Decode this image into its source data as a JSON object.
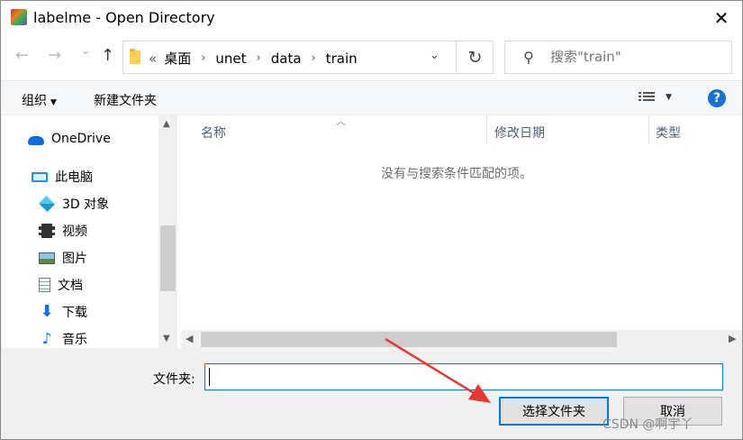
{
  "window": {
    "title": "labelme - Open Directory",
    "close_glyph": "✕"
  },
  "nav": {
    "back_glyph": "←",
    "forward_glyph": "→",
    "recent_glyph": "⌄",
    "up_glyph": "↑",
    "refresh_glyph": "↻",
    "dropdown_glyph": "⌄",
    "lead": "«",
    "breadcrumbs": [
      "桌面",
      "unet",
      "data",
      "train"
    ],
    "sep": "›"
  },
  "search": {
    "placeholder": "搜索\"train\""
  },
  "toolbar": {
    "organize": "组织",
    "new_folder": "新建文件夹",
    "help": "?"
  },
  "sidebar": {
    "items": [
      {
        "label": "OneDrive",
        "icon": "cloud-icon"
      },
      {
        "label": "此电脑",
        "icon": "computer-icon"
      },
      {
        "label": "3D 对象",
        "icon": "cube-icon"
      },
      {
        "label": "视频",
        "icon": "film-icon"
      },
      {
        "label": "图片",
        "icon": "picture-icon"
      },
      {
        "label": "文档",
        "icon": "document-icon"
      },
      {
        "label": "下载",
        "icon": "download-icon"
      },
      {
        "label": "音乐",
        "icon": "music-icon"
      }
    ]
  },
  "filelist": {
    "columns": [
      "名称",
      "修改日期",
      "类型"
    ],
    "empty_message": "没有与搜索条件匹配的项。"
  },
  "footer": {
    "folder_label": "文件夹:",
    "folder_value": "",
    "select_button": "选择文件夹",
    "cancel_button": "取消"
  },
  "watermark": "CSDN @啊宇丫",
  "colors": {
    "accent": "#0078d7",
    "annotation": "#e53935"
  }
}
